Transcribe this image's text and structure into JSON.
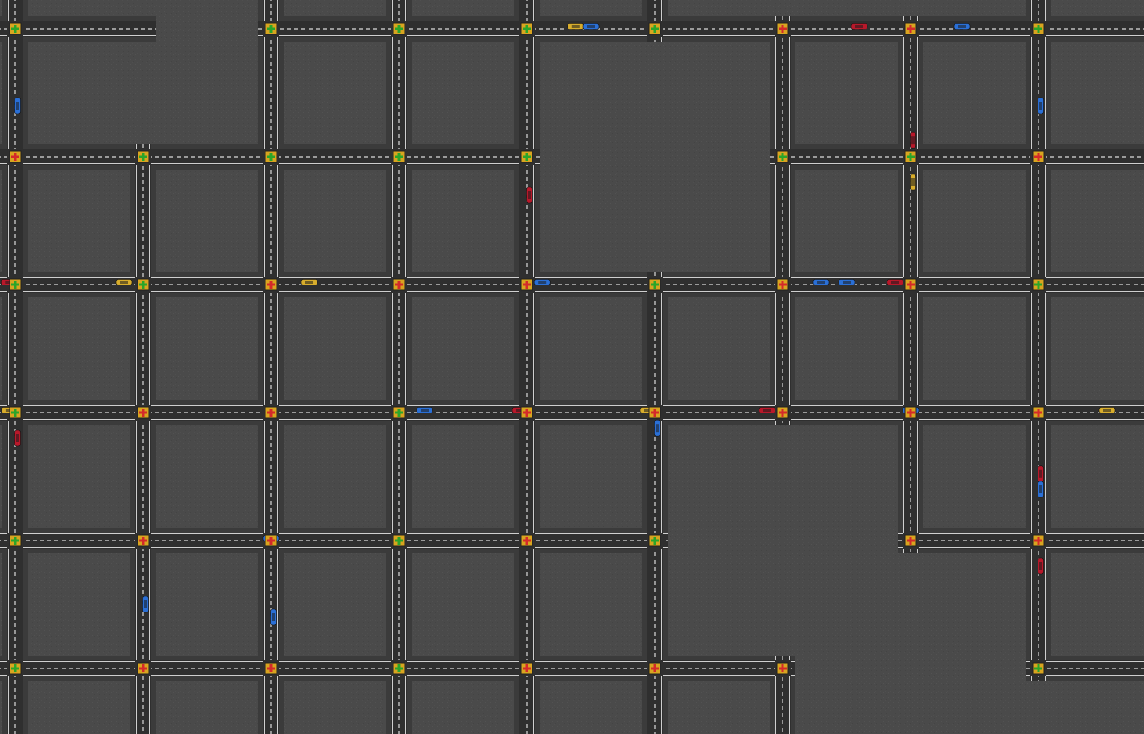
{
  "game": {
    "scene": "traffic-grid-simulation",
    "colors": {
      "ground": "#4a4a4a",
      "road": "#2f2f2f",
      "road_edge": "#3a3a3a",
      "lane_mark": "#dcdcdc",
      "signal_box": "#d9a520",
      "signal_red": "#d42a2a",
      "signal_green": "#2aa52a",
      "car_red": "#b8182a",
      "car_blue": "#2a6fd6",
      "car_yellow": "#d8ad2c"
    },
    "grid": {
      "columns": 9,
      "rows": 6,
      "column_lines": [
        19,
        179,
        339,
        499,
        659,
        819,
        979,
        1139,
        1299
      ],
      "row_lines": [
        36,
        196,
        356,
        516,
        676,
        836
      ]
    },
    "roads_h": [
      {
        "row": 0,
        "from": -1,
        "to": 1,
        "open_left": true,
        "open_right": false
      },
      {
        "row": 0,
        "from": 2,
        "to": 9,
        "open_left": false,
        "open_right": true
      },
      {
        "row": 1,
        "from": -1,
        "to": 4,
        "open_left": true,
        "open_right": false
      },
      {
        "row": 1,
        "from": 6,
        "to": 9,
        "open_left": false,
        "open_right": true
      },
      {
        "row": 2,
        "from": -1,
        "to": 9,
        "open_left": true,
        "open_right": true
      },
      {
        "row": 3,
        "from": -1,
        "to": 9,
        "open_left": true,
        "open_right": true
      },
      {
        "row": 4,
        "from": -1,
        "to": 5,
        "open_left": true,
        "open_right": false
      },
      {
        "row": 4,
        "from": 7,
        "to": 9,
        "open_left": false,
        "open_right": true
      },
      {
        "row": 5,
        "from": -1,
        "to": 6,
        "open_left": true,
        "open_right": false
      },
      {
        "row": 5,
        "from": 8,
        "to": 9,
        "open_left": false,
        "open_right": true
      }
    ],
    "roads_v": [
      {
        "col": 0,
        "from": -1,
        "to": 6
      },
      {
        "col": 1,
        "from": 1,
        "to": 6
      },
      {
        "col": 2,
        "from": -1,
        "to": 6
      },
      {
        "col": 3,
        "from": -1,
        "to": 6
      },
      {
        "col": 4,
        "from": -1,
        "to": 6
      },
      {
        "col": 5,
        "from": -1,
        "to": 0
      },
      {
        "col": 5,
        "from": 2,
        "to": 6
      },
      {
        "col": 6,
        "from": 0,
        "to": 3
      },
      {
        "col": 6,
        "from": 5,
        "to": 6
      },
      {
        "col": 7,
        "from": 0,
        "to": 4
      },
      {
        "col": 8,
        "from": -1,
        "to": 5
      }
    ],
    "intersections": [
      {
        "col": 0,
        "row": 0,
        "state": "green"
      },
      {
        "col": 2,
        "row": 0,
        "state": "green"
      },
      {
        "col": 3,
        "row": 0,
        "state": "green"
      },
      {
        "col": 4,
        "row": 0,
        "state": "green"
      },
      {
        "col": 5,
        "row": 0,
        "state": "green"
      },
      {
        "col": 6,
        "row": 0,
        "state": "red"
      },
      {
        "col": 7,
        "row": 0,
        "state": "red"
      },
      {
        "col": 8,
        "row": 0,
        "state": "green"
      },
      {
        "col": 0,
        "row": 1,
        "state": "red"
      },
      {
        "col": 1,
        "row": 1,
        "state": "green"
      },
      {
        "col": 2,
        "row": 1,
        "state": "green"
      },
      {
        "col": 3,
        "row": 1,
        "state": "green"
      },
      {
        "col": 4,
        "row": 1,
        "state": "green"
      },
      {
        "col": 6,
        "row": 1,
        "state": "green"
      },
      {
        "col": 7,
        "row": 1,
        "state": "green"
      },
      {
        "col": 8,
        "row": 1,
        "state": "red"
      },
      {
        "col": 0,
        "row": 2,
        "state": "green"
      },
      {
        "col": 1,
        "row": 2,
        "state": "green"
      },
      {
        "col": 2,
        "row": 2,
        "state": "red"
      },
      {
        "col": 3,
        "row": 2,
        "state": "red"
      },
      {
        "col": 4,
        "row": 2,
        "state": "red"
      },
      {
        "col": 5,
        "row": 2,
        "state": "green"
      },
      {
        "col": 6,
        "row": 2,
        "state": "red"
      },
      {
        "col": 7,
        "row": 2,
        "state": "red"
      },
      {
        "col": 8,
        "row": 2,
        "state": "green"
      },
      {
        "col": 0,
        "row": 3,
        "state": "green"
      },
      {
        "col": 1,
        "row": 3,
        "state": "red"
      },
      {
        "col": 2,
        "row": 3,
        "state": "red"
      },
      {
        "col": 3,
        "row": 3,
        "state": "green"
      },
      {
        "col": 4,
        "row": 3,
        "state": "red"
      },
      {
        "col": 5,
        "row": 3,
        "state": "red"
      },
      {
        "col": 6,
        "row": 3,
        "state": "red"
      },
      {
        "col": 7,
        "row": 3,
        "state": "red"
      },
      {
        "col": 8,
        "row": 3,
        "state": "red"
      },
      {
        "col": 0,
        "row": 4,
        "state": "green"
      },
      {
        "col": 1,
        "row": 4,
        "state": "red"
      },
      {
        "col": 2,
        "row": 4,
        "state": "red"
      },
      {
        "col": 3,
        "row": 4,
        "state": "green"
      },
      {
        "col": 4,
        "row": 4,
        "state": "red"
      },
      {
        "col": 5,
        "row": 4,
        "state": "green"
      },
      {
        "col": 7,
        "row": 4,
        "state": "red"
      },
      {
        "col": 8,
        "row": 4,
        "state": "red"
      },
      {
        "col": 0,
        "row": 5,
        "state": "green"
      },
      {
        "col": 1,
        "row": 5,
        "state": "red"
      },
      {
        "col": 2,
        "row": 5,
        "state": "red"
      },
      {
        "col": 3,
        "row": 5,
        "state": "green"
      },
      {
        "col": 4,
        "row": 5,
        "state": "red"
      },
      {
        "col": 5,
        "row": 5,
        "state": "red"
      },
      {
        "col": 6,
        "row": 5,
        "state": "red"
      },
      {
        "col": 8,
        "row": 5,
        "state": "green"
      }
    ],
    "cars": [
      {
        "color": "yellow",
        "dir": "h",
        "col": 4,
        "row": 0,
        "t": 0.38
      },
      {
        "color": "blue",
        "dir": "h",
        "col": 4,
        "row": 0,
        "t": 0.5
      },
      {
        "color": "red",
        "dir": "h",
        "col": 6,
        "row": 0,
        "t": 0.6
      },
      {
        "color": "blue",
        "dir": "h",
        "col": 7,
        "row": 0,
        "t": 0.4
      },
      {
        "color": "blue",
        "dir": "v",
        "col": 0,
        "row": 0,
        "t": 0.6
      },
      {
        "color": "blue",
        "dir": "v",
        "col": 8,
        "row": 0,
        "t": 0.6
      },
      {
        "color": "red",
        "dir": "v",
        "col": 7,
        "row": 0,
        "t": 0.87
      },
      {
        "color": "yellow",
        "dir": "v",
        "col": 7,
        "row": 1,
        "t": 0.2
      },
      {
        "color": "red",
        "dir": "v",
        "col": 4,
        "row": 1,
        "t": 0.3
      },
      {
        "color": "red",
        "dir": "h",
        "col": -1,
        "row": 2,
        "t": 0.87
      },
      {
        "color": "yellow",
        "dir": "h",
        "col": 0,
        "row": 2,
        "t": 0.85
      },
      {
        "color": "yellow",
        "dir": "h",
        "col": 2,
        "row": 2,
        "t": 0.3
      },
      {
        "color": "blue",
        "dir": "h",
        "col": 4,
        "row": 2,
        "t": 0.12
      },
      {
        "color": "blue",
        "dir": "h",
        "col": 6,
        "row": 2,
        "t": 0.3
      },
      {
        "color": "blue",
        "dir": "h",
        "col": 6,
        "row": 2,
        "t": 0.5
      },
      {
        "color": "red",
        "dir": "h",
        "col": 6,
        "row": 2,
        "t": 0.88
      },
      {
        "color": "yellow",
        "dir": "h",
        "col": -1,
        "row": 3,
        "t": 0.88
      },
      {
        "color": "blue",
        "dir": "h",
        "col": 3,
        "row": 3,
        "t": 0.2
      },
      {
        "color": "red",
        "dir": "h",
        "col": 3,
        "row": 3,
        "t": 0.95
      },
      {
        "color": "yellow",
        "dir": "h",
        "col": 4,
        "row": 3,
        "t": 0.95
      },
      {
        "color": "red",
        "dir": "h",
        "col": 5,
        "row": 3,
        "t": 0.88
      },
      {
        "color": "blue",
        "dir": "h",
        "col": 7,
        "row": 3,
        "t": 0.0
      },
      {
        "color": "yellow",
        "dir": "h",
        "col": 8,
        "row": 3,
        "t": 0.5
      },
      {
        "color": "blue",
        "dir": "v",
        "col": 5,
        "row": 3,
        "t": 0.12
      },
      {
        "color": "red",
        "dir": "v",
        "col": 0,
        "row": 3,
        "t": 0.2
      },
      {
        "color": "red",
        "dir": "v",
        "col": 8,
        "row": 3,
        "t": 0.48
      },
      {
        "color": "blue",
        "dir": "v",
        "col": 8,
        "row": 3,
        "t": 0.6
      },
      {
        "color": "red",
        "dir": "v",
        "col": 8,
        "row": 4,
        "t": 0.2
      },
      {
        "color": "blue",
        "dir": "h",
        "col": 2,
        "row": 4,
        "t": 0.0
      },
      {
        "color": "blue",
        "dir": "v",
        "col": 1,
        "row": 4,
        "t": 0.5
      },
      {
        "color": "blue",
        "dir": "v",
        "col": 2,
        "row": 4,
        "t": 0.6
      }
    ]
  }
}
